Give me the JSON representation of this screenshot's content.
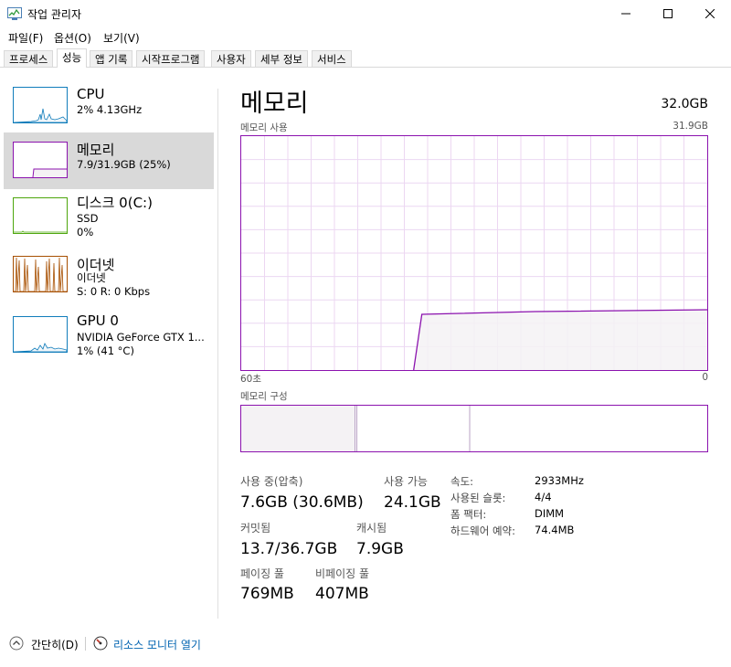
{
  "window": {
    "title": "작업 관리자",
    "controls": {
      "minimize": "—",
      "maximize": "☐",
      "close": "✕"
    }
  },
  "menu": [
    {
      "label": "파일(F)"
    },
    {
      "label": "옵션(O)"
    },
    {
      "label": "보기(V)"
    }
  ],
  "tabs": [
    {
      "label": "프로세스"
    },
    {
      "label": "성능",
      "active": true
    },
    {
      "label": "앱 기록"
    },
    {
      "label": "시작프로그램"
    },
    {
      "label": "사용자"
    },
    {
      "label": "세부 정보"
    },
    {
      "label": "서비스"
    }
  ],
  "resources": [
    {
      "name": "CPU",
      "lines": [
        "2% 4.13GHz"
      ],
      "color": "#117dbb",
      "fill": "#f1f6fa"
    },
    {
      "name": "메모리",
      "lines": [
        "7.9/31.9GB (25%)"
      ],
      "color": "#8b12ae",
      "fill": "#f4f2f4",
      "selected": true
    },
    {
      "name": "디스크 0(C:)",
      "lines": [
        "SSD",
        "0%"
      ],
      "color": "#4da60c",
      "fill": "#eff7ea"
    },
    {
      "name": "이더넷",
      "lines": [
        "이더넷",
        "S: 0 R: 0 Kbps"
      ],
      "color": "#a74f01",
      "fill": "#fcf3eb"
    },
    {
      "name": "GPU 0",
      "lines": [
        "NVIDIA GeForce GTX 1...",
        "1% (41 °C)"
      ],
      "color": "#117dbb",
      "fill": "#f1f6fa"
    }
  ],
  "detail": {
    "title": "메모리",
    "total": "32.0GB",
    "usage_label": "메모리 사용",
    "usage_max": "31.9GB",
    "axis_left": "60초",
    "axis_right": "0",
    "usage_fraction": 0.25,
    "composition_label": "메모리 구성",
    "stats": {
      "in_use_label": "사용 중(압축)",
      "in_use_value": "7.6GB (30.6MB)",
      "available_label": "사용 가능",
      "available_value": "24.1GB",
      "committed_label": "커밋됨",
      "committed_value": "13.7/36.7GB",
      "cached_label": "캐시됨",
      "cached_value": "7.9GB",
      "paged_label": "페이징 풀",
      "paged_value": "769MB",
      "nonpaged_label": "비페이징 풀",
      "nonpaged_value": "407MB"
    },
    "kv": [
      {
        "label": "속도:",
        "value": "2933MHz"
      },
      {
        "label": "사용된 슬롯:",
        "value": "4/4"
      },
      {
        "label": "폼 팩터:",
        "value": "DIMM"
      },
      {
        "label": "하드웨어 예약:",
        "value": "74.4MB"
      }
    ]
  },
  "footer": {
    "collapse": "간단히(D)",
    "resource_monitor": "리소스 모니터 열기"
  },
  "icons": {
    "app": "task-manager-icon",
    "collapse": "chevron-up-circle-icon",
    "monitor": "resource-monitor-icon"
  }
}
